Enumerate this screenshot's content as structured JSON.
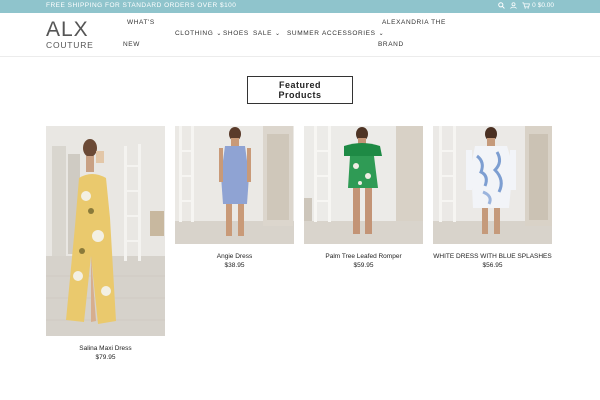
{
  "topbar": {
    "promo": "FREE SHIPPING FOR STANDARD ORDERS OVER $100",
    "cart_count": "0",
    "cart_total": "$0.00"
  },
  "logo": {
    "line1": "ALX",
    "line2": "COUTURE"
  },
  "nav": {
    "whats_new_1": "WHAT'S",
    "whats_new_2": "NEW",
    "clothing": "CLOTHING",
    "shoes": "SHOES",
    "sale": "SALE",
    "summer": "SUMMER",
    "accessories": "ACCESSORIES",
    "alexandria_1": "ALEXANDRIA THE",
    "alexandria_2": "BRAND"
  },
  "featured": {
    "title": "Featured Products"
  },
  "products": [
    {
      "name": "Salina Maxi Dress",
      "price": "$79.95"
    },
    {
      "name": "Angie Dress",
      "price": "$38.95"
    },
    {
      "name": "Palm Tree Leafed Romper",
      "price": "$59.95"
    },
    {
      "name": "WHITE DRESS WITH BLUE SPLASHES",
      "price": "$56.95"
    }
  ],
  "colors": {
    "topbar": "#8fc4cc",
    "text": "#222222"
  },
  "icons": [
    "search-icon",
    "user-icon",
    "cart-icon",
    "chevron-down-icon"
  ]
}
